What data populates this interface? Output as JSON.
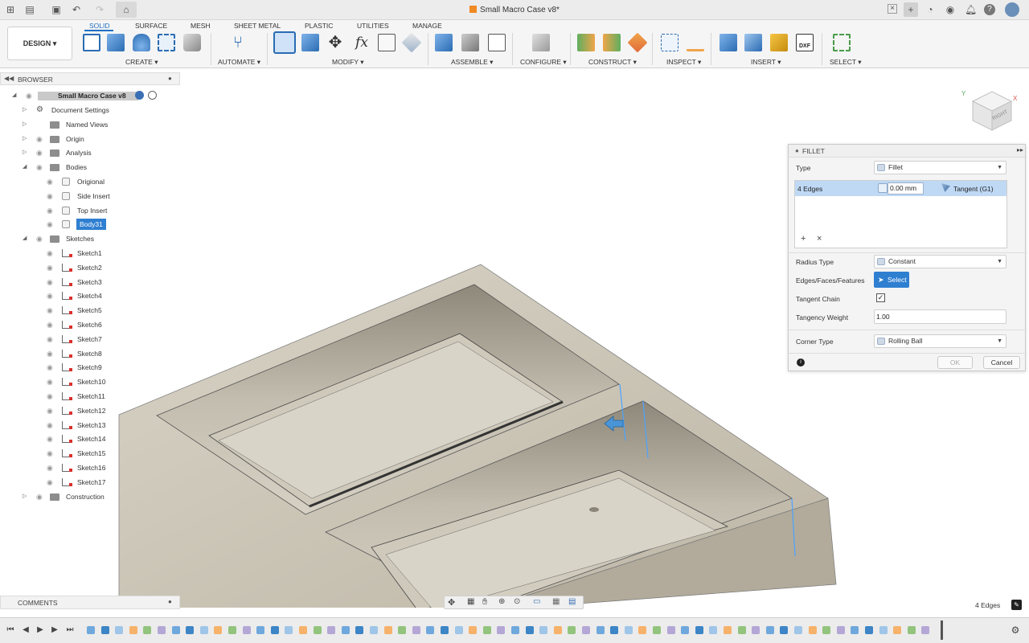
{
  "window": {
    "title": "Small Macro Case v8*"
  },
  "ribbon": {
    "workspace_button": "DESIGN ▾",
    "tabs": [
      "SOLID",
      "SURFACE",
      "MESH",
      "SHEET METAL",
      "PLASTIC",
      "UTILITIES",
      "MANAGE"
    ],
    "active_tab": "SOLID",
    "groups": [
      "CREATE ▾",
      "AUTOMATE ▾",
      "MODIFY ▾",
      "ASSEMBLE ▾",
      "CONFIGURE ▾",
      "CONSTRUCT ▾",
      "INSPECT ▾",
      "INSERT ▾",
      "SELECT ▾"
    ]
  },
  "browser": {
    "title": "BROWSER",
    "root": "Small Macro Case v8",
    "items": [
      {
        "label": "Document Settings",
        "type": "settings"
      },
      {
        "label": "Named Views",
        "type": "folder"
      },
      {
        "label": "Origin",
        "type": "folder"
      },
      {
        "label": "Analysis",
        "type": "folder"
      },
      {
        "label": "Bodies",
        "type": "folder"
      },
      {
        "label": "Origional",
        "type": "body"
      },
      {
        "label": "Side Insert",
        "type": "body"
      },
      {
        "label": "Top Insert",
        "type": "body"
      },
      {
        "label": "Body31",
        "type": "body",
        "selected": true
      },
      {
        "label": "Sketches",
        "type": "folder"
      },
      {
        "label": "Sketch1",
        "type": "sketch"
      },
      {
        "label": "Sketch2",
        "type": "sketch"
      },
      {
        "label": "Sketch3",
        "type": "sketch"
      },
      {
        "label": "Sketch4",
        "type": "sketch"
      },
      {
        "label": "Sketch5",
        "type": "sketch"
      },
      {
        "label": "Sketch6",
        "type": "sketch"
      },
      {
        "label": "Sketch7",
        "type": "sketch"
      },
      {
        "label": "Sketch8",
        "type": "sketch"
      },
      {
        "label": "Sketch9",
        "type": "sketch"
      },
      {
        "label": "Sketch10",
        "type": "sketch"
      },
      {
        "label": "Sketch11",
        "type": "sketch"
      },
      {
        "label": "Sketch12",
        "type": "sketch"
      },
      {
        "label": "Sketch13",
        "type": "sketch"
      },
      {
        "label": "Sketch14",
        "type": "sketch"
      },
      {
        "label": "Sketch15",
        "type": "sketch"
      },
      {
        "label": "Sketch16",
        "type": "sketch"
      },
      {
        "label": "Sketch17",
        "type": "sketch"
      },
      {
        "label": "Construction",
        "type": "folder"
      }
    ]
  },
  "comments": {
    "title": "COMMENTS"
  },
  "fillet": {
    "title": "FILLET",
    "type_label": "Type",
    "type_value": "Fillet",
    "selection_label": "4 Edges",
    "radius_value": "0.00 mm",
    "continuity_value": "Tangent (G1)",
    "radius_type_label": "Radius Type",
    "radius_type_value": "Constant",
    "edges_label": "Edges/Faces/Features",
    "select_button": "Select",
    "tangent_chain_label": "Tangent Chain",
    "tangent_chain_checked": true,
    "tangency_weight_label": "Tangency Weight",
    "tangency_weight_value": "1.00",
    "corner_type_label": "Corner Type",
    "corner_type_value": "Rolling Ball",
    "ok_button": "OK",
    "cancel_button": "Cancel"
  },
  "viewcube": {
    "face": "RIGHT",
    "axis_y": "Y",
    "axis_x": "X"
  },
  "status": {
    "selection_count": "4 Edges"
  },
  "colors": {
    "accent": "#1f6fc5",
    "selection": "#2f7fd1",
    "model": "#c9c3b4"
  }
}
